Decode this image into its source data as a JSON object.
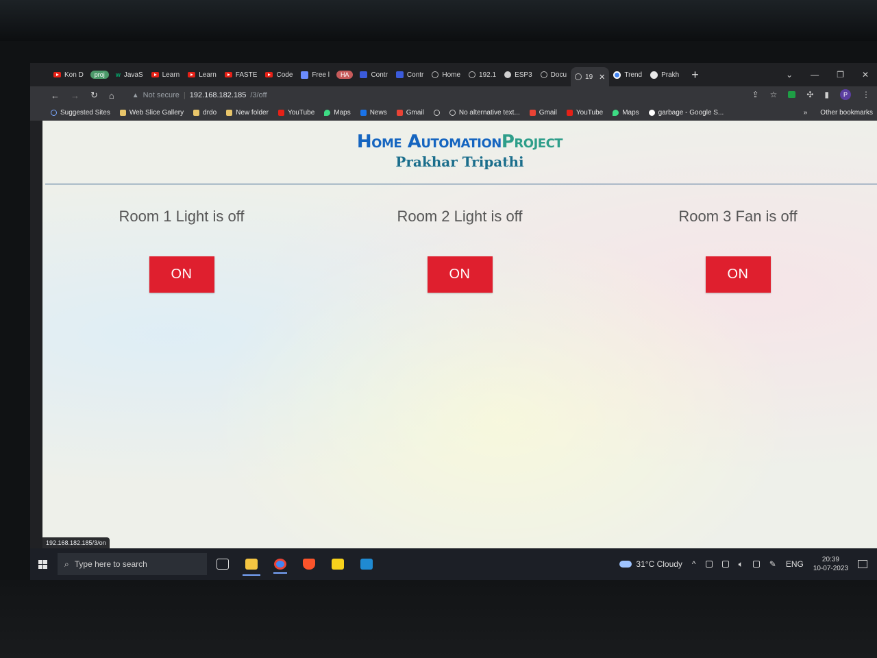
{
  "browser": {
    "tabs": [
      {
        "label": "Kon D",
        "icon": "youtube-icon"
      },
      {
        "label": "JavaS",
        "icon": "w3schools-icon"
      },
      {
        "label": "Learn",
        "icon": "youtube-icon"
      },
      {
        "label": "Learn",
        "icon": "youtube-icon"
      },
      {
        "label": "FASTE",
        "icon": "youtube-icon"
      },
      {
        "label": "Code",
        "icon": "youtube-icon"
      },
      {
        "label": "Free l",
        "icon": "free-icon"
      },
      {
        "label": "Contr",
        "icon": "square-icon"
      },
      {
        "label": "Contr",
        "icon": "square-icon"
      },
      {
        "label": "Home",
        "icon": "globe-icon"
      },
      {
        "label": "192.1",
        "icon": "globe-icon"
      },
      {
        "label": "ESP3",
        "icon": "wordpress-icon"
      },
      {
        "label": "Docu",
        "icon": "globe-icon"
      },
      {
        "label": "19",
        "icon": "globe-icon"
      },
      {
        "label": "Trend",
        "icon": "trend-icon"
      },
      {
        "label": "Prakh",
        "icon": "github-icon"
      }
    ],
    "tab_groups": {
      "group1": "proj",
      "group2": "HA"
    },
    "address": {
      "security": "Not secure",
      "host": "192.168.182.185",
      "path": "/3/off"
    },
    "bookmarks": [
      {
        "label": "Suggested Sites",
        "icon": "search-icon"
      },
      {
        "label": "Web Slice Gallery",
        "icon": "web-slice-icon"
      },
      {
        "label": "drdo",
        "icon": "folder-icon"
      },
      {
        "label": "New folder",
        "icon": "folder-icon"
      },
      {
        "label": "YouTube",
        "icon": "youtube-icon"
      },
      {
        "label": "Maps",
        "icon": "maps-icon"
      },
      {
        "label": "News",
        "icon": "news-icon"
      },
      {
        "label": "Gmail",
        "icon": "gmail-icon"
      },
      {
        "label": "",
        "icon": "globe-icon"
      },
      {
        "label": "No alternative text...",
        "icon": "globe-icon"
      },
      {
        "label": "Gmail",
        "icon": "gmail-icon"
      },
      {
        "label": "YouTube",
        "icon": "youtube-icon"
      },
      {
        "label": "Maps",
        "icon": "maps-icon"
      },
      {
        "label": "garbage - Google S...",
        "icon": "google-icon"
      }
    ],
    "bookmarks_more": "»",
    "other_bookmarks": "Other bookmarks",
    "profile_initial": "P",
    "hover_url": "192.168.182.185/3/on"
  },
  "page": {
    "title_part1": "Home",
    "title_part2": "Automation",
    "title_part3": "Project",
    "subtitle": "Prakhar Tripathi",
    "rooms": [
      {
        "status": "Room 1 Light is off",
        "button": "ON"
      },
      {
        "status": "Room 2 Light is off",
        "button": "ON"
      },
      {
        "status": "Room 3 Fan is off",
        "button": "ON"
      }
    ],
    "colors": {
      "button": "#df1f2e",
      "title": "#1565c0",
      "title_accent": "#2e9e8a",
      "subtitle": "#1b6e8c"
    }
  },
  "taskbar": {
    "search_placeholder": "Type here to search",
    "weather": "31°C  Cloudy",
    "language": "ENG",
    "time": "20:39",
    "date": "10-07-2023"
  }
}
